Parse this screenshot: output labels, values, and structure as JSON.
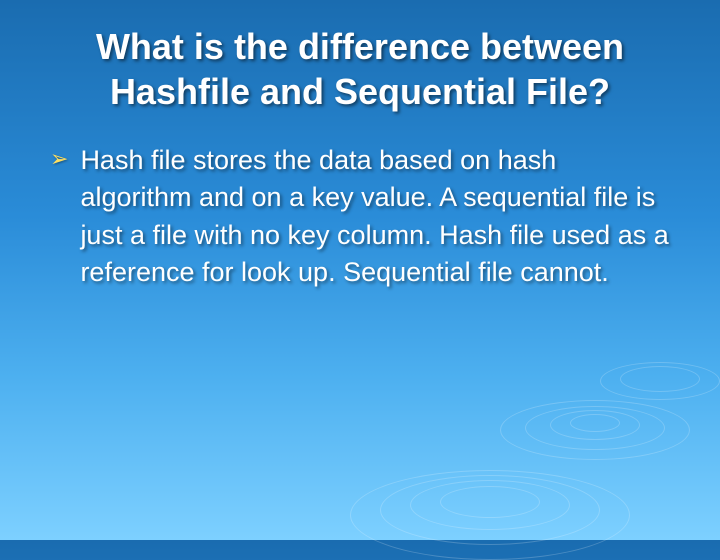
{
  "slide": {
    "title": "What is the difference between Hashfile and Sequential File?",
    "bullets": [
      {
        "text": "Hash file stores the data based on hash algorithm and on a key value. A sequential file is just a file with no key column. Hash file used as a reference for look up. Sequential file cannot."
      }
    ]
  }
}
